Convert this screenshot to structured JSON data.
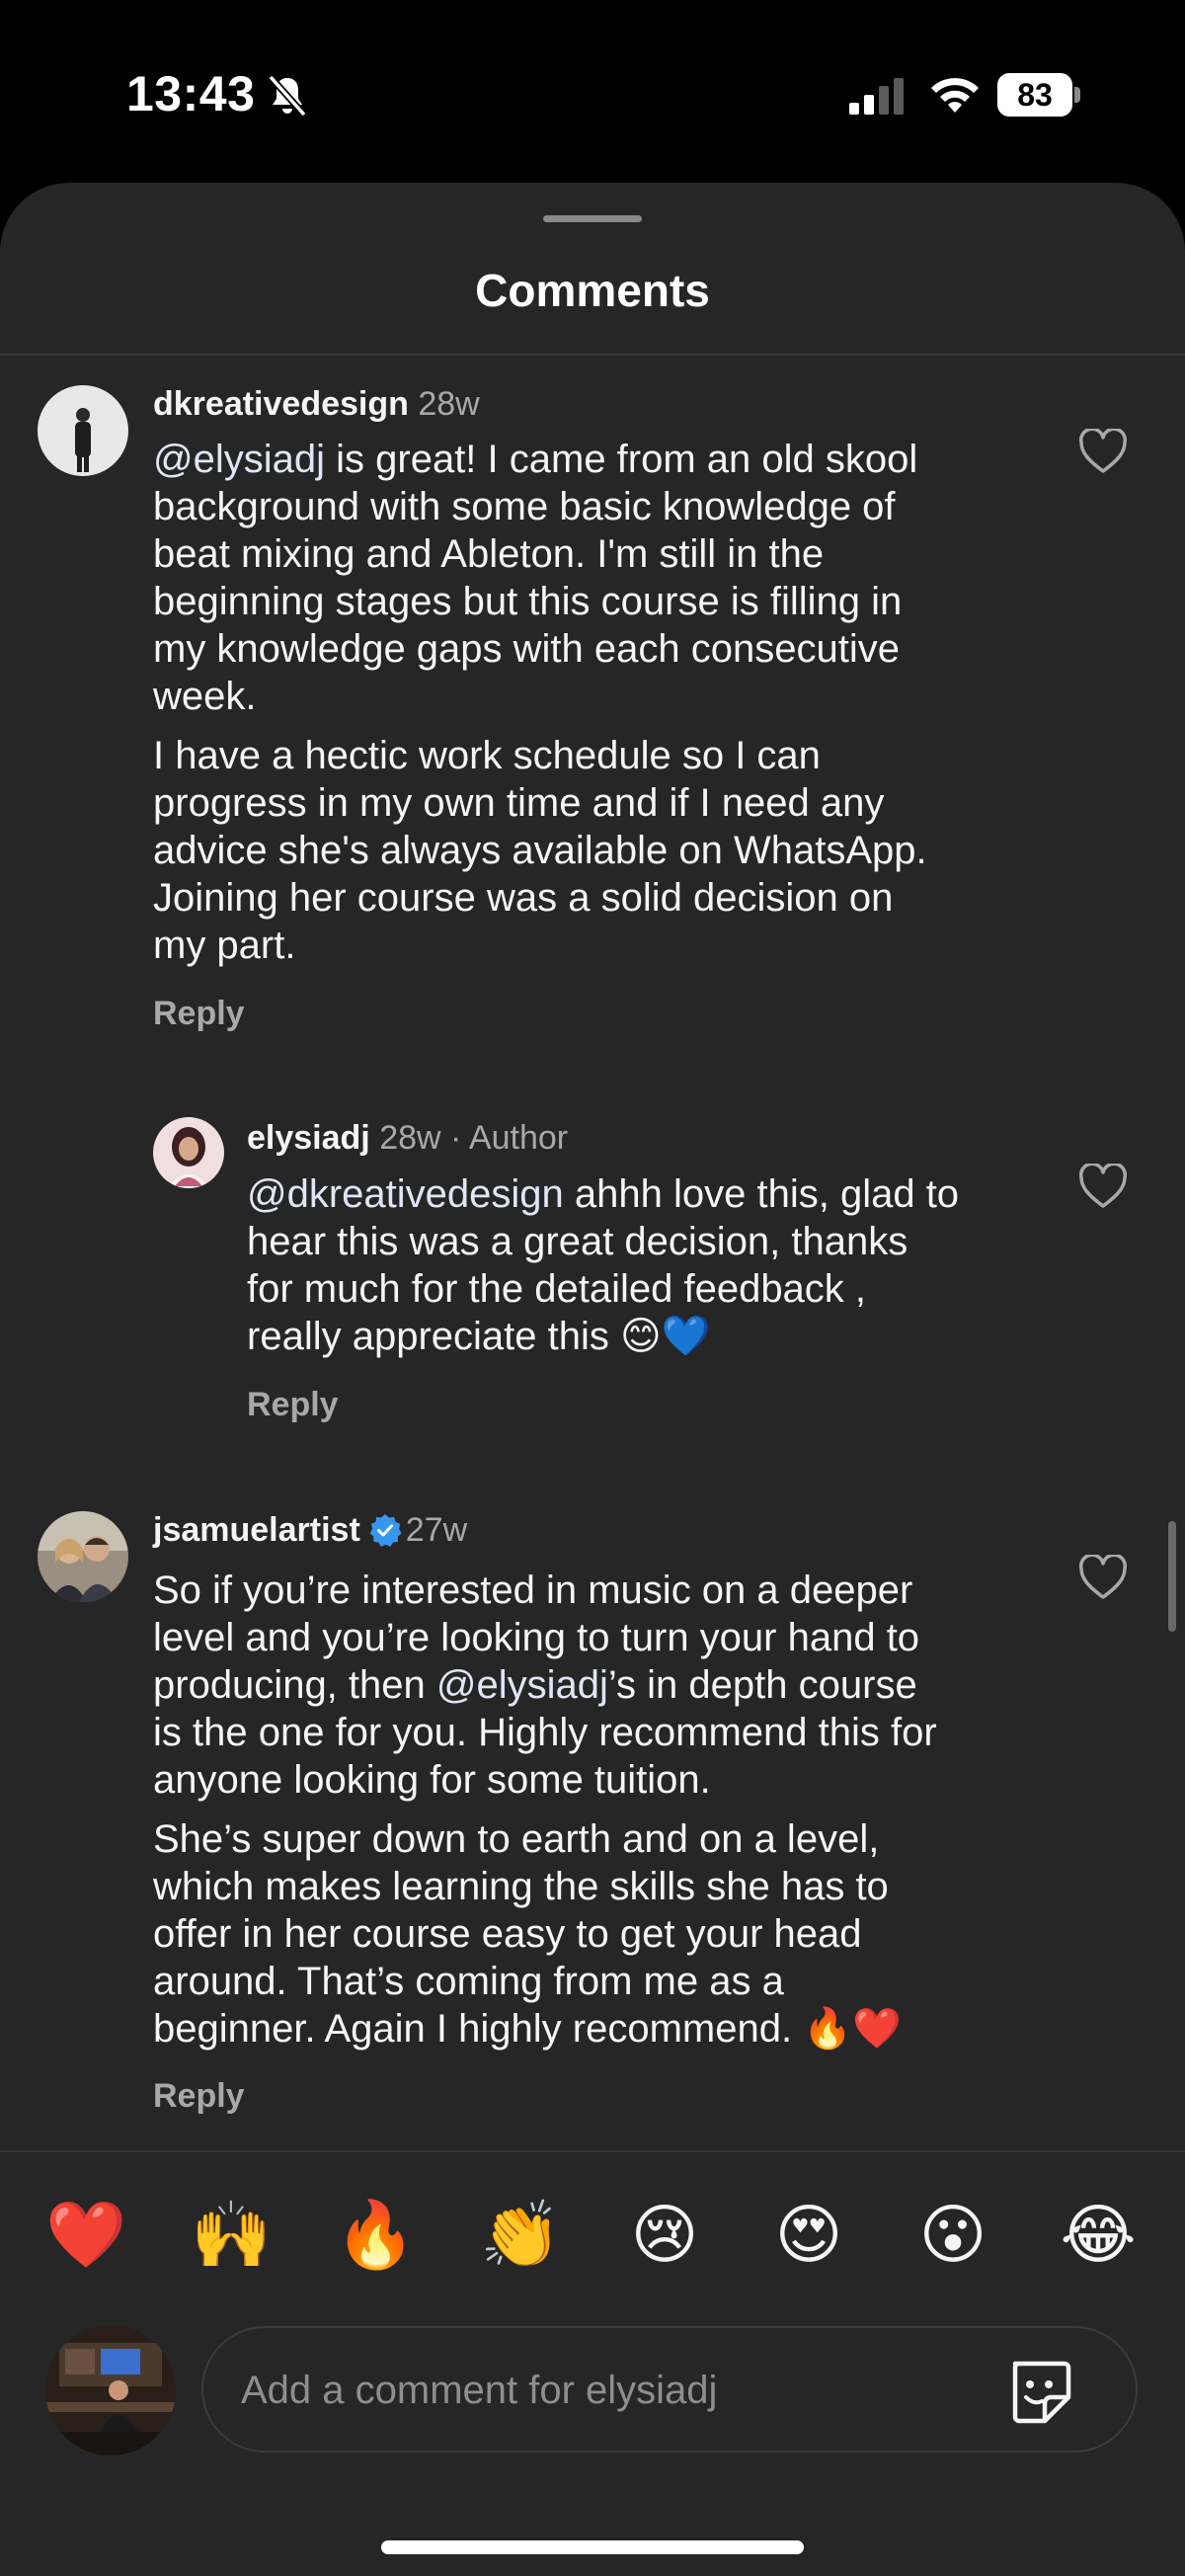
{
  "status_bar": {
    "time": "13:43",
    "battery": "83",
    "icons": [
      "silent-bell-icon",
      "cellular-signal-icon",
      "wifi-icon",
      "battery-icon"
    ]
  },
  "sheet": {
    "title": "Comments"
  },
  "comments": [
    {
      "username": "dkreativedesign",
      "meta": "28w",
      "mention": "@elysiadj",
      "para1": " is great! I came from an old skool\nbackground with some basic knowledge of\nbeat mixing and Ableton. I'm still in the\nbeginning stages but this course is filling in\nmy knowledge gaps with each consecutive\nweek.",
      "para2": "I have a hectic work schedule so I can\nprogress in my own time and if I need any\nadvice she's always available on WhatsApp.\nJoining her course was a solid decision on\nmy part.",
      "reply": "Reply"
    },
    {
      "username": "elysiadj",
      "meta": "28w · Author",
      "mention": "@dkreativedesign",
      "para1": " ahhh love this, glad to\nhear this was a great decision, thanks\nfor much for the detailed feedback ,\nreally appreciate this 😊💙",
      "reply": "Reply"
    },
    {
      "username": "jsamuelartist",
      "meta": "27w",
      "line1": "So if you’re interested in music on a deeper\nlevel and you’re looking to turn your hand to\nproducing, then ",
      "mention": "@elysiadj",
      "line2": "’s in depth course\nis the one for you. Highly recommend this for\nanyone looking for some tuition.",
      "para2": "She’s super down to earth and on a level,\nwhich makes learning the skills she has to\noffer in her course easy to get your head\naround. That’s coming from me as a\nbeginner. Again I highly recommend. 🔥❤️",
      "reply": "Reply"
    }
  ],
  "reactions": [
    "❤️",
    "🙌",
    "🔥",
    "👏",
    "😢",
    "😍",
    "😮",
    "😂"
  ],
  "composer": {
    "placeholder": "Add a comment for elysiadj"
  },
  "colors": {
    "sheet_bg": "#262626",
    "verified_blue": "#3797f0",
    "secondary_text": "#a8a8a8"
  }
}
